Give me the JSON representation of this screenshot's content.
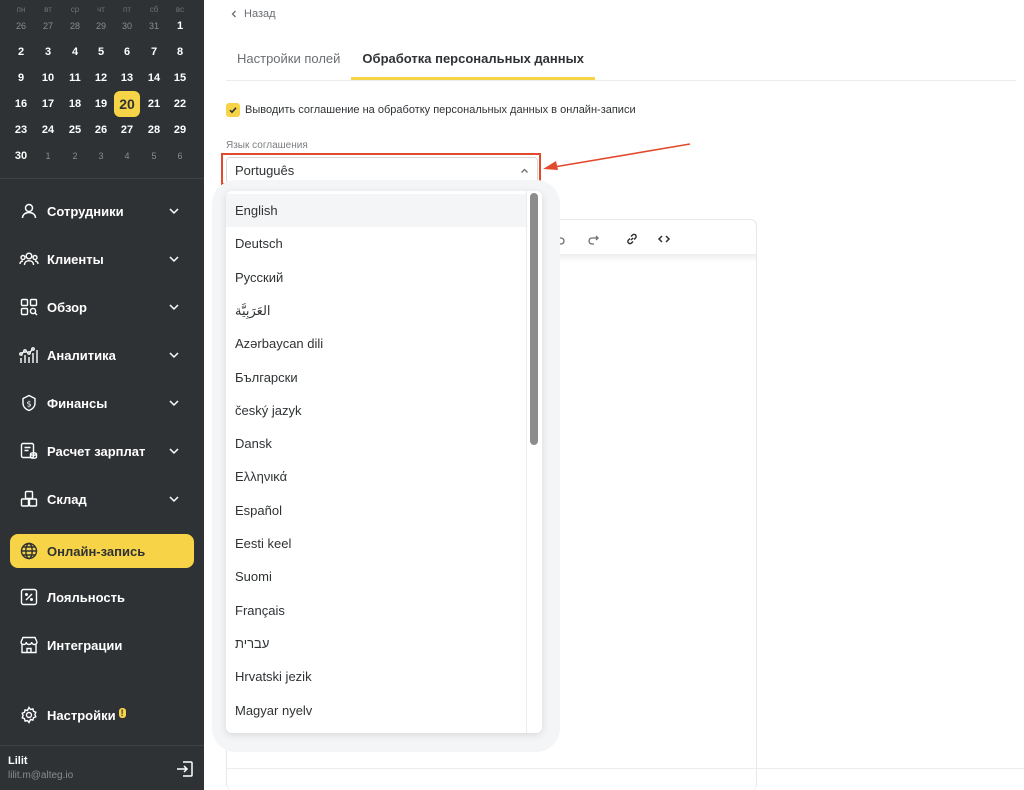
{
  "calendar": {
    "weekdays": [
      "пн",
      "вт",
      "ср",
      "чт",
      "пт",
      "сб",
      "вс"
    ],
    "rows": [
      [
        {
          "d": "26",
          "dim": true
        },
        {
          "d": "27",
          "dim": true
        },
        {
          "d": "28",
          "dim": true
        },
        {
          "d": "29",
          "dim": true
        },
        {
          "d": "30",
          "dim": true
        },
        {
          "d": "31",
          "dim": true
        },
        {
          "d": "1"
        }
      ],
      [
        {
          "d": "2"
        },
        {
          "d": "3"
        },
        {
          "d": "4"
        },
        {
          "d": "5"
        },
        {
          "d": "6"
        },
        {
          "d": "7"
        },
        {
          "d": "8"
        }
      ],
      [
        {
          "d": "9"
        },
        {
          "d": "10"
        },
        {
          "d": "11"
        },
        {
          "d": "12"
        },
        {
          "d": "13"
        },
        {
          "d": "14"
        },
        {
          "d": "15"
        }
      ],
      [
        {
          "d": "16"
        },
        {
          "d": "17"
        },
        {
          "d": "18"
        },
        {
          "d": "19"
        },
        {
          "d": "20",
          "today": true
        },
        {
          "d": "21"
        },
        {
          "d": "22"
        }
      ],
      [
        {
          "d": "23"
        },
        {
          "d": "24"
        },
        {
          "d": "25"
        },
        {
          "d": "26"
        },
        {
          "d": "27"
        },
        {
          "d": "28"
        },
        {
          "d": "29"
        }
      ],
      [
        {
          "d": "30"
        },
        {
          "d": "1",
          "dim": true
        },
        {
          "d": "2",
          "dim": true
        },
        {
          "d": "3",
          "dim": true
        },
        {
          "d": "4",
          "dim": true
        },
        {
          "d": "5",
          "dim": true
        },
        {
          "d": "6",
          "dim": true
        }
      ]
    ]
  },
  "sidebar": {
    "items": [
      {
        "label": "Сотрудники",
        "icon": "user-icon",
        "chevron": true
      },
      {
        "label": "Клиенты",
        "icon": "users-icon",
        "chevron": true
      },
      {
        "label": "Обзор",
        "icon": "grid-search-icon",
        "chevron": true
      },
      {
        "label": "Аналитика",
        "icon": "analytics-icon",
        "chevron": true
      },
      {
        "label": "Финансы",
        "icon": "dollar-shield-icon",
        "chevron": true
      },
      {
        "label": "Расчет зарплат",
        "icon": "payroll-icon",
        "chevron": true
      },
      {
        "label": "Склад",
        "icon": "boxes-icon",
        "chevron": true
      },
      {
        "label": "Онлайн-запись",
        "icon": "globe-icon",
        "chevron": false,
        "active": true
      },
      {
        "label": "Лояльность",
        "icon": "percent-icon",
        "chevron": false
      },
      {
        "label": "Интеграции",
        "icon": "store-icon",
        "chevron": false
      }
    ],
    "settings": {
      "label": "Настройки",
      "badge": "!"
    },
    "user": {
      "name": "Lilit",
      "email": "lilit.m@alteg.io"
    }
  },
  "main": {
    "back_label": "Назад",
    "tabs": [
      {
        "label": "Настройки полей",
        "active": false
      },
      {
        "label": "Обработка персональных данных",
        "active": true
      }
    ],
    "checkbox_label": "Выводить соглашение на обработку персональных данных в онлайн-записи",
    "checkbox_checked": true,
    "language_label": "Язык соглашения",
    "language_value": "Português",
    "options": [
      "English",
      "Deutsch",
      "Русский",
      "العَرَبِيَّة",
      "Azərbaycan dili",
      "Български",
      "český jazyk",
      "Dansk",
      "Ελληνικά",
      "Español",
      "Eesti keel",
      "Suomi",
      "Français",
      "עברית",
      "Hrvatski jezik",
      "Magyar nyelv"
    ],
    "highlighted_option": "English"
  },
  "colors": {
    "sidebar_bg": "#2f3234",
    "accent": "#f7d348",
    "annotation": "#e24a2e"
  }
}
